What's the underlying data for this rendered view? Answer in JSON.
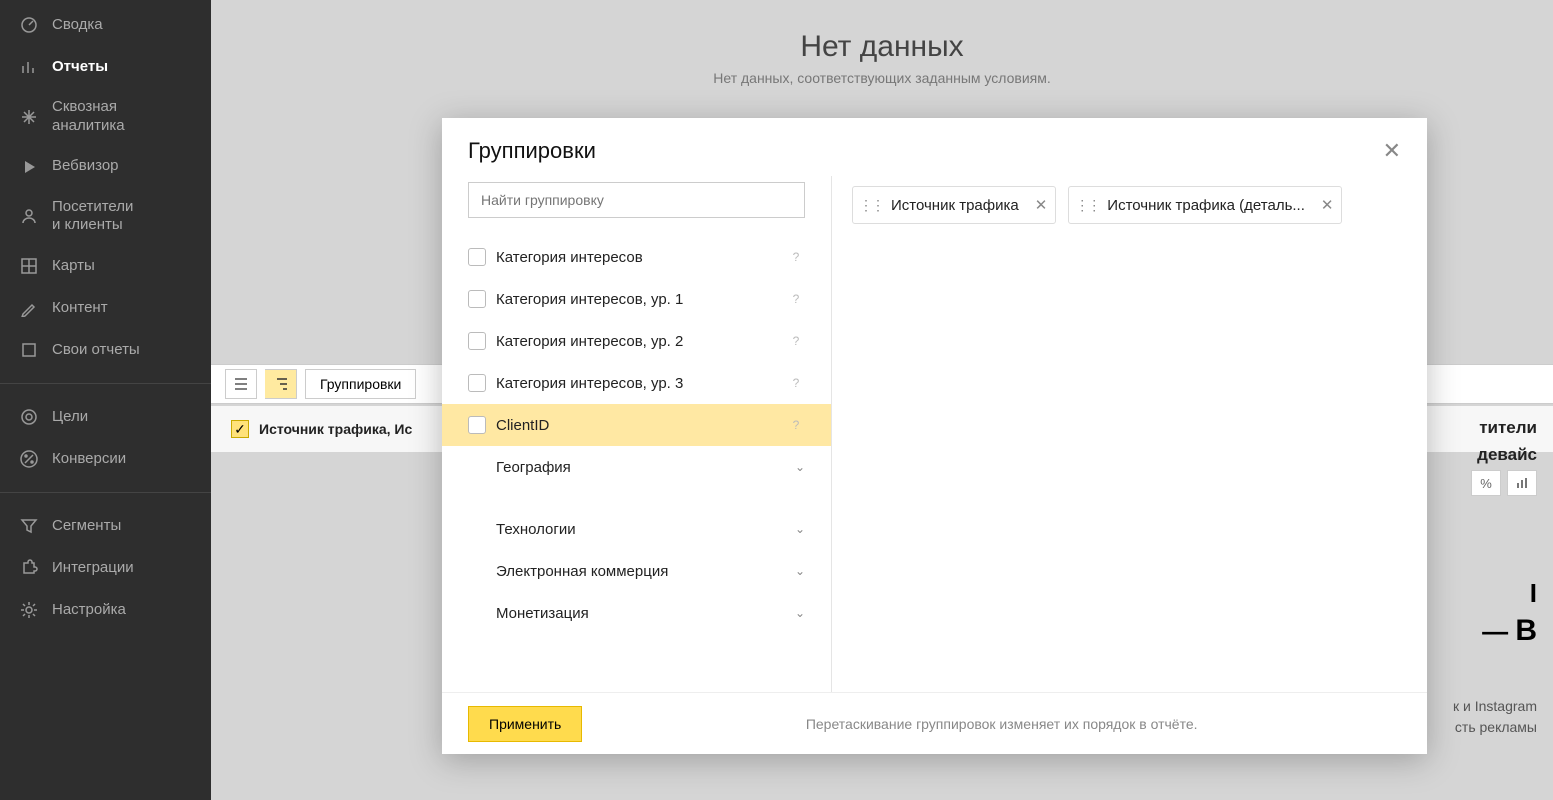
{
  "sidebar": {
    "items": [
      {
        "label": "Сводка",
        "icon": "gauge"
      },
      {
        "label": "Отчеты",
        "icon": "bar-chart",
        "active": true
      },
      {
        "label": "Сквозная\nаналитика",
        "icon": "asterisk"
      },
      {
        "label": "Вебвизор",
        "icon": "play"
      },
      {
        "label": "Посетители\nи клиенты",
        "icon": "person"
      },
      {
        "label": "Карты",
        "icon": "grid"
      },
      {
        "label": "Контент",
        "icon": "pencil"
      },
      {
        "label": "Свои отчеты",
        "icon": "square"
      }
    ],
    "items2": [
      {
        "label": "Цели",
        "icon": "target"
      },
      {
        "label": "Конверсии",
        "icon": "percent"
      }
    ],
    "items3": [
      {
        "label": "Сегменты",
        "icon": "funnel"
      },
      {
        "label": "Интеграции",
        "icon": "puzzle"
      },
      {
        "label": "Настройка",
        "icon": "gear"
      }
    ]
  },
  "main": {
    "no_data_title": "Нет данных",
    "no_data_subtitle": "Нет данных, соответствующих заданным условиям.",
    "group_btn": "Группировки",
    "subheader_text": "Источник трафика, Ис",
    "right1": "тители",
    "right2": "девайс",
    "pct": "%",
    "slogan_r1": "І",
    "slogan_dash": "—",
    "slogan_r2": "В",
    "tail1": "к и Instagram",
    "tail2": "сть рекламы"
  },
  "modal": {
    "title": "Группировки",
    "search_placeholder": "Найти группировку",
    "tree": [
      {
        "label": "Категория интересов",
        "checkbox": true,
        "help": true
      },
      {
        "label": "Категория интересов, ур. 1",
        "checkbox": true,
        "help": true
      },
      {
        "label": "Категория интересов, ур. 2",
        "checkbox": true,
        "help": true
      },
      {
        "label": "Категория интересов, ур. 3",
        "checkbox": true,
        "help": true
      },
      {
        "label": "ClientID",
        "checkbox": true,
        "help": true,
        "highlight": true
      },
      {
        "label": "География",
        "expandable": true
      },
      {
        "gap": true
      },
      {
        "label": "Технологии",
        "expandable": true
      },
      {
        "label": "Электронная коммерция",
        "expandable": true
      },
      {
        "label": "Монетизация",
        "expandable": true
      }
    ],
    "chips": [
      "Источник трафика",
      "Источник трафика (деталь..."
    ],
    "apply": "Применить",
    "hint": "Перетаскивание группировок изменяет их порядок в отчёте."
  }
}
